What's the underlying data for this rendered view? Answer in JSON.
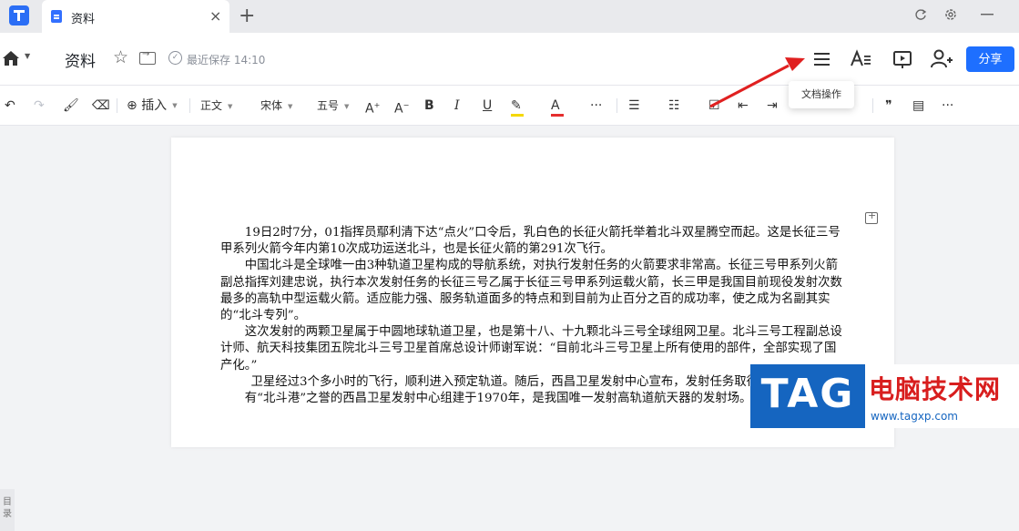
{
  "tab": {
    "title": "资料",
    "close_glyph": "×",
    "new_glyph": "+"
  },
  "header": {
    "doc_title": "资料",
    "save_status": "最近保存 14:10",
    "share_label": "分享"
  },
  "toolbar": {
    "insert_label": "插入",
    "style_label": "正文",
    "font_label": "宋体",
    "size_label": "五号",
    "bold": "B",
    "italic": "I",
    "underline": "U",
    "more": "···",
    "quote": "❞",
    "highlight_color": "#f5d800",
    "font_color": "#e52e2e"
  },
  "tooltip": "文档操作",
  "document": {
    "paragraphs": [
      "19日2时7分，01指挥员鄢利清下达“点火”口令后，乳白色的长征火箭托举着北斗双星腾空而起。这是长征三号甲系列火箭今年内第10次成功运送北斗，也是长征火箭的第291次飞行。",
      "中国北斗是全球唯一由3种轨道卫星构成的导航系统，对执行发射任务的火箭要求非常高。长征三号甲系列火箭副总指挥刘建忠说，执行本次发射任务的长征三号乙属于长征三号甲系列运载火箭，长三甲是我国目前现役发射次数最多的高轨中型运载火箭。适应能力强、服务轨道面多的特点和到目前为止百分之百的成功率，使之成为名副其实的“北斗专列”。",
      "这次发射的两颗卫星属于中圆地球轨道卫星，也是第十八、十九颗北斗三号全球组网卫星。北斗三号工程副总设计师、航天科技集团五院北斗三号卫星首席总设计师谢军说：“目前北斗三号卫星上所有使用的部件，全部实现了国产化。”",
      "卫星经过3个多小时的飞行，顺利进入预定轨道。随后，西昌卫星发射中心宣布，发射任务取得圆满成功。",
      "有“北斗港”之誉的西昌卫星发射中心组建于1970年，是我国唯一发射高轨道航天器的发射场。"
    ]
  },
  "outline_tab": "目录",
  "watermark": {
    "tag": "TAG",
    "title": "电脑技术网",
    "url": "www.tagxp.com"
  }
}
